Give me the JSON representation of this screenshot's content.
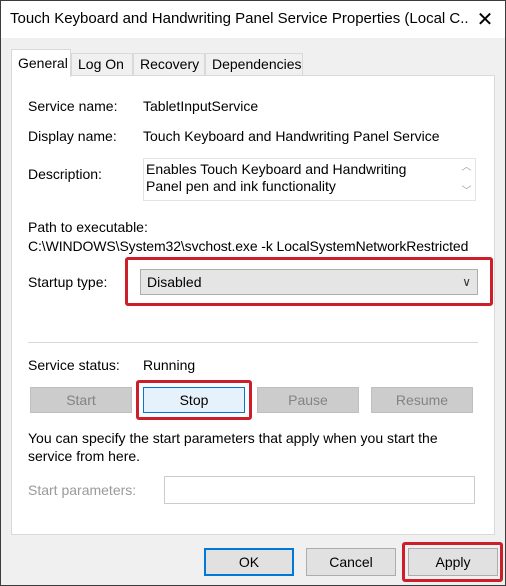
{
  "window": {
    "title": "Touch Keyboard and Handwriting Panel Service Properties (Local C...",
    "close_glyph": "✕"
  },
  "tabs": [
    {
      "label": "General",
      "active": true
    },
    {
      "label": "Log On",
      "active": false
    },
    {
      "label": "Recovery",
      "active": false
    },
    {
      "label": "Dependencies",
      "active": false
    }
  ],
  "general": {
    "service_name_label": "Service name:",
    "service_name_value": "TabletInputService",
    "display_name_label": "Display name:",
    "display_name_value": "Touch Keyboard and Handwriting Panel Service",
    "description_label": "Description:",
    "description_value": "Enables Touch Keyboard and Handwriting Panel pen and ink functionality",
    "path_label": "Path to executable:",
    "path_value": "C:\\WINDOWS\\System32\\svchost.exe -k LocalSystemNetworkRestricted",
    "startup_type_label": "Startup type:",
    "startup_type_value": "Disabled",
    "service_status_label": "Service status:",
    "service_status_value": "Running",
    "start_label": "Start",
    "stop_label": "Stop",
    "pause_label": "Pause",
    "resume_label": "Resume",
    "hint_text": "You can specify the start parameters that apply when you start the service from here.",
    "start_params_label": "Start parameters:"
  },
  "footer": {
    "ok_label": "OK",
    "cancel_label": "Cancel",
    "apply_label": "Apply"
  },
  "colors": {
    "highlight": "#cc1f2a",
    "focus": "#0078d7"
  }
}
